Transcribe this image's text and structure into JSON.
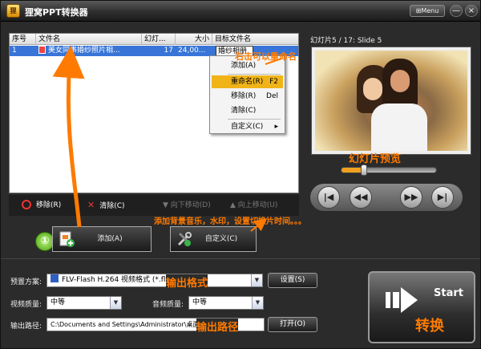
{
  "window": {
    "title": "狸窝PPT转换器",
    "menu_label": "Menu",
    "minimize": "—",
    "close": "×"
  },
  "list": {
    "headers": [
      "序号",
      "文件名",
      "幻灯...",
      "大小",
      "目标文件名"
    ],
    "rows": [
      {
        "index": "1",
        "filename": "美女同事婚纱照片相...",
        "slides": "17",
        "size": "24,00...",
        "target": "婚纱相册"
      }
    ]
  },
  "context_menu": {
    "items": [
      {
        "label": "添加(A)",
        "shortcut": ""
      },
      {
        "label": "重命名(R)",
        "shortcut": "F2"
      },
      {
        "label": "移除(R)",
        "shortcut": "Del"
      },
      {
        "label": "清除(C)",
        "shortcut": ""
      },
      {
        "label": "自定义(C)",
        "shortcut": "▸"
      }
    ]
  },
  "list_toolbar": {
    "remove": "移除(R)",
    "clear": "清除(C)",
    "move_down": "向下移动(D)",
    "move_up": "向上移动(U)"
  },
  "actions": {
    "add": "添加(A)",
    "customize": "自定义(C)",
    "step": "①"
  },
  "preview": {
    "title": "幻灯片5 / 17: Slide 5",
    "progress": 0.24
  },
  "settings": {
    "preset_label": "预置方案:",
    "preset_value": "FLV-Flash H.264 视频格式 (*.flv)",
    "settings_btn": "设置(S)",
    "video_quality_label": "视频质量:",
    "video_quality_value": "中等",
    "audio_quality_label": "音频质量:",
    "audio_quality_value": "中等",
    "output_label": "输出路径:",
    "output_value": "C:\\Documents and Settings\\Administrator\\桌面",
    "open_btn": "打开(O)"
  },
  "start": {
    "label": "Start",
    "cn": "转换"
  },
  "annotations": {
    "rename": "右击可以重命名",
    "preview": "幻灯片预览",
    "custom": "添加背景音乐，水印，设置切换片时间。。。",
    "format": "输出格式",
    "path": "输出路径"
  },
  "colors": {
    "accent": "#ff7a00",
    "selection": "#3875d7",
    "menu_highlight": "#f0b419"
  }
}
